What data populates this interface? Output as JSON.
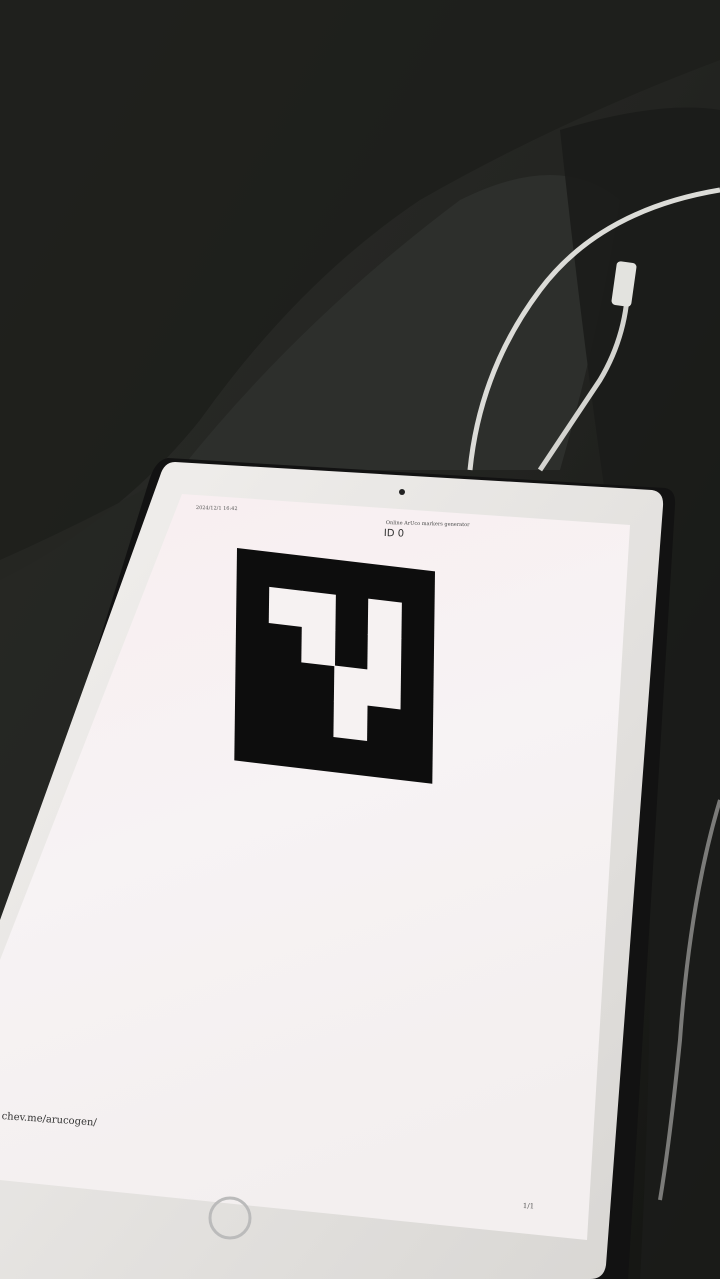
{
  "scene": {
    "description_type": "photo",
    "colors": {
      "screen": "#f7f2f3",
      "bezel": "#e9e7e5",
      "case": "#111111",
      "marker_black": "#0d0d0d",
      "marker_white": "#f6f2f2",
      "fabric": "#2b2c29",
      "cable": "#d9d9d6"
    }
  },
  "document": {
    "date": "2024/12/1 16:42",
    "heading": "Online ArUco markers generator",
    "marker_id": "ID 0",
    "url": "chev.me/arucogen/",
    "page_number": "1/1"
  },
  "marker": {
    "dictionary_grid": 6,
    "cells": [
      [
        0,
        0,
        0,
        0,
        0,
        0
      ],
      [
        0,
        1,
        1,
        0,
        1,
        0
      ],
      [
        0,
        0,
        1,
        0,
        1,
        0
      ],
      [
        0,
        0,
        0,
        1,
        1,
        0
      ],
      [
        0,
        0,
        0,
        1,
        0,
        0
      ],
      [
        0,
        0,
        0,
        0,
        0,
        0
      ]
    ]
  }
}
